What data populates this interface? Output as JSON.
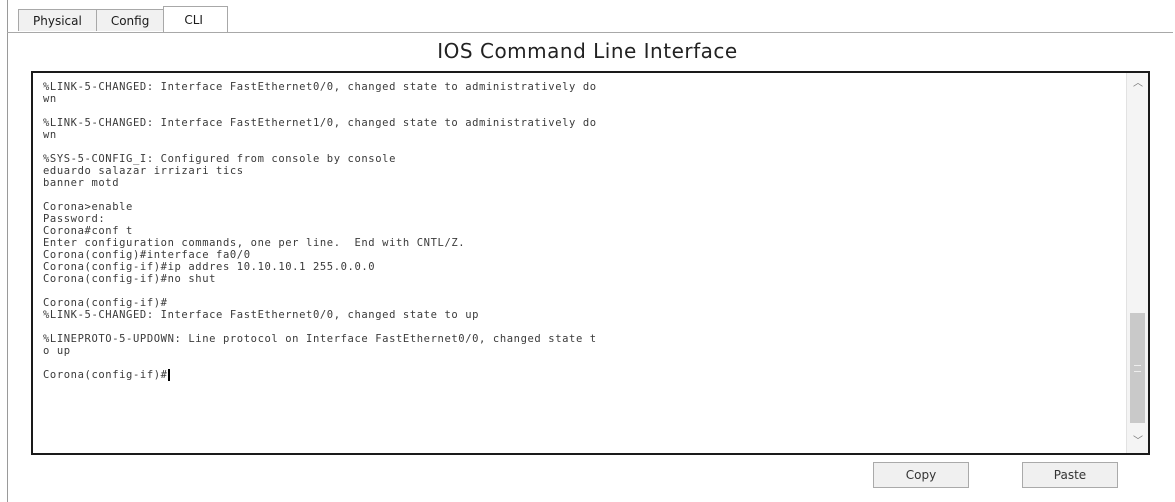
{
  "tabs": [
    {
      "label": "Physical",
      "active": false
    },
    {
      "label": "Config",
      "active": false
    },
    {
      "label": "CLI",
      "active": true
    }
  ],
  "panel_title": "IOS Command Line Interface",
  "console": {
    "lines": [
      "%LINK-5-CHANGED: Interface FastEthernet0/0, changed state to administratively do",
      "wn",
      "",
      "%LINK-5-CHANGED: Interface FastEthernet1/0, changed state to administratively do",
      "wn",
      "",
      "%SYS-5-CONFIG_I: Configured from console by console",
      "eduardo salazar irrizari tics",
      "banner motd",
      "",
      "Corona>enable",
      "Password:",
      "Corona#conf t",
      "Enter configuration commands, one per line.  End with CNTL/Z.",
      "Corona(config)#interface fa0/0",
      "Corona(config-if)#ip addres 10.10.10.1 255.0.0.0",
      "Corona(config-if)#no shut",
      "",
      "Corona(config-if)#",
      "%LINK-5-CHANGED: Interface FastEthernet0/0, changed state to up",
      "",
      "%LINEPROTO-5-UPDOWN: Line protocol on Interface FastEthernet0/0, changed state t",
      "o up",
      "",
      "Corona(config-if)#"
    ]
  },
  "buttons": {
    "copy_label": "Copy",
    "paste_label": "Paste"
  },
  "icons": {
    "scroll_up": "chevron-up-icon",
    "scroll_down": "chevron-down-icon"
  }
}
